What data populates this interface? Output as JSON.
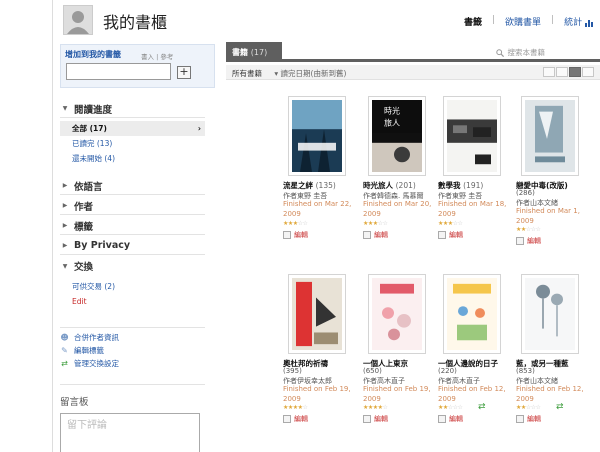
{
  "header": {
    "title": "我的書櫃",
    "nav": {
      "books": "書籤",
      "wishlist": "欲購書單",
      "stats": "統計"
    }
  },
  "sidebar": {
    "add_title": "增加到我的書籤",
    "add_hint": "書入 | 參考",
    "add_button": "+",
    "read_status": {
      "title": "閱讀進度",
      "items": [
        {
          "label": "全部 (17)"
        },
        {
          "label": "已讀完 (13)"
        },
        {
          "label": "還未開始 (4)"
        }
      ]
    },
    "sections": [
      "依語言",
      "作者",
      "標籤",
      "By Privacy"
    ],
    "exchange": {
      "title": "交換",
      "items": [
        "可供交易 (2)",
        "Edit"
      ]
    },
    "links": [
      "合併作者資訊",
      "編輯標籤",
      "管理交換設定"
    ],
    "message": {
      "title": "留言板",
      "placeholder": "留下評論"
    }
  },
  "main": {
    "tab_label": "書籍",
    "tab_count": "(17)",
    "search_placeholder": "搜索本書籍",
    "filter_all": "所有書籍",
    "filter_sort": "▾ 讀完日期(由新到舊)"
  },
  "books": [
    {
      "title": "流星之絆",
      "count": "(135)",
      "author": "作者東野 圭吾",
      "finished": "Finished on Mar 22, 2009",
      "rating": 3,
      "edit": "編輯",
      "exchange": false
    },
    {
      "title": "時光旅人",
      "count": "(201)",
      "author": "作者韓德森. 馬慕爾",
      "finished": "Finished on Mar 20, 2009",
      "rating": 3,
      "edit": "編輯",
      "exchange": false
    },
    {
      "title": "數學我",
      "count": "(191)",
      "author": "作者東野 圭吾",
      "finished": "Finished on Mar 18, 2009",
      "rating": 3,
      "edit": "編輯",
      "exchange": false
    },
    {
      "title": "戀愛中毒(改版)",
      "count": "(286)",
      "author": "作者山本文緒",
      "finished": "Finished on Mar 1, 2009",
      "rating": 2,
      "edit": "編輯",
      "exchange": false
    },
    {
      "title": "奧杜邦的祈禱",
      "count": "(395)",
      "author": "作者伊坂幸太郎",
      "finished": "Finished on Feb 19, 2009",
      "rating": 4,
      "edit": "編輯",
      "exchange": false
    },
    {
      "title": "一個人上東京",
      "count": "(650)",
      "author": "作者高木直子",
      "finished": "Finished on Feb 19, 2009",
      "rating": 4,
      "edit": "編輯",
      "exchange": false
    },
    {
      "title": "一個人邊說的日子",
      "count": "(220)",
      "author": "作者高木直子",
      "finished": "Finished on Feb 12, 2009",
      "rating": 2,
      "edit": "編輯",
      "exchange": true
    },
    {
      "title": "藍，或另一種藍",
      "count": "(853)",
      "author": "作者山本文緒",
      "finished": "Finished on Feb 12, 2009",
      "rating": 2,
      "edit": "編輯",
      "exchange": true
    }
  ]
}
